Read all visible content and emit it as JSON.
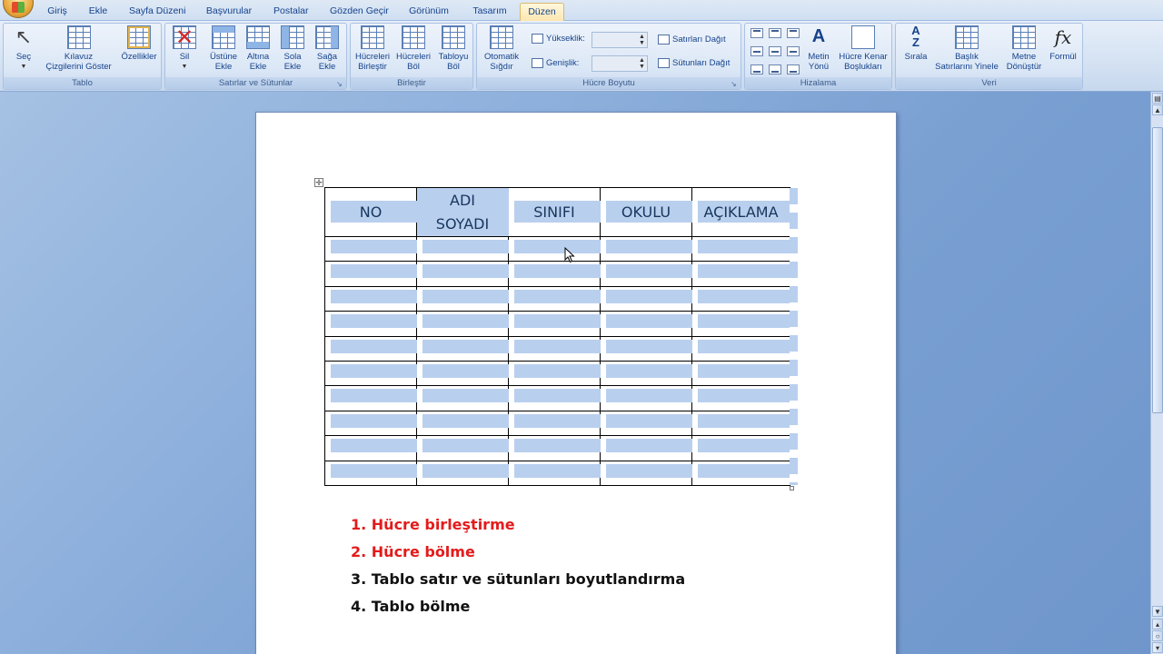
{
  "tabs": [
    {
      "label": "Giriş"
    },
    {
      "label": "Ekle"
    },
    {
      "label": "Sayfa Düzeni"
    },
    {
      "label": "Başvurular"
    },
    {
      "label": "Postalar"
    },
    {
      "label": "Gözden Geçir"
    },
    {
      "label": "Görünüm"
    },
    {
      "label": "Tasarım"
    },
    {
      "label": "Düzen",
      "active": true
    }
  ],
  "ribbon": {
    "tablo": {
      "label": "Tablo",
      "sec": "Seç",
      "kilavuz_line1": "Kılavuz",
      "kilavuz_line2": "Çizgilerini Göster",
      "ozellikler": "Özellikler"
    },
    "satirlar": {
      "label": "Satırlar ve Sütunlar",
      "sil": "Sil",
      "ustune_1": "Üstüne",
      "ustune_2": "Ekle",
      "altina_1": "Altına",
      "altina_2": "Ekle",
      "sola_1": "Sola",
      "sola_2": "Ekle",
      "saga_1": "Sağa",
      "saga_2": "Ekle"
    },
    "birlestir": {
      "label": "Birleştir",
      "hucreleri_birlestir_1": "Hücreleri",
      "hucreleri_birlestir_2": "Birleştir",
      "hucreleri_bol_1": "Hücreleri",
      "hucreleri_bol_2": "Böl",
      "tabloyu_bol_1": "Tabloyu",
      "tabloyu_bol_2": "Böl"
    },
    "hucre_boyutu": {
      "label": "Hücre Boyutu",
      "otomatik_1": "Otomatik",
      "otomatik_2": "Sığdır",
      "yukseklik": "Yükseklik:",
      "genislik": "Genişlik:",
      "satirlari_dagit": "Satırları Dağıt",
      "sutunlari_dagit": "Sütunları Dağıt"
    },
    "hizalama": {
      "label": "Hizalama",
      "metin_yonu_1": "Metin",
      "metin_yonu_2": "Yönü",
      "hucre_kenar_1": "Hücre Kenar",
      "hucre_kenar_2": "Boşlukları"
    },
    "veri": {
      "label": "Veri",
      "sirala": "Sırala",
      "baslik_1": "Başlık",
      "baslik_2": "Satırlarını Yinele",
      "metne_1": "Metne",
      "metne_2": "Dönüştür",
      "formul": "Formül"
    }
  },
  "document": {
    "table_headers": [
      "NO",
      "ADI SOYADI",
      "SINIFI",
      "OKULU",
      "AÇIKLAMA"
    ],
    "adi_line1": "ADI",
    "adi_line2": "SOYADI",
    "empty_rows": 10,
    "list": [
      {
        "text": "1. Hücre birleştirme",
        "color": "#e31b1b"
      },
      {
        "text": "2. Hücre bölme",
        "color": "#e31b1b"
      },
      {
        "text": "3. Tablo satır ve sütunları boyutlandırma",
        "color": "#111111"
      },
      {
        "text": "4. Tablo bölme",
        "color": "#111111"
      }
    ]
  },
  "icons": {
    "table_move": "move-icon",
    "fx": "fx"
  }
}
